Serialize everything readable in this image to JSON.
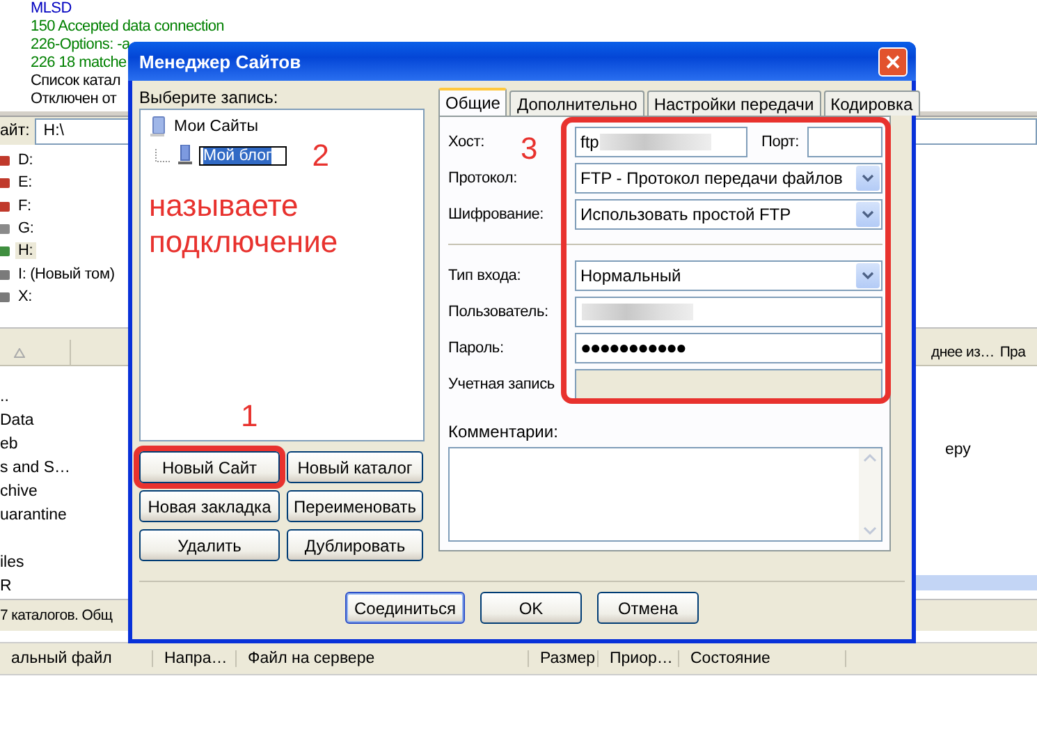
{
  "log": [
    {
      "text": "MLSD",
      "color": "#0000c0"
    },
    {
      "text": "150 Accepted data connection",
      "color": "#008000"
    },
    {
      "text": "226-Options: -a",
      "color": "#008000"
    },
    {
      "text": "226 18 matche",
      "color": "#008000"
    },
    {
      "text": "Список катал",
      "color": "#000000"
    },
    {
      "text": "Отключен от",
      "color": "#000000"
    }
  ],
  "local_path": {
    "label": "айт:",
    "value": "H:\\"
  },
  "drives": [
    {
      "label": "D:",
      "kind": "network",
      "selected": false
    },
    {
      "label": "E:",
      "kind": "network",
      "selected": false
    },
    {
      "label": "F:",
      "kind": "network",
      "selected": false
    },
    {
      "label": "G:",
      "kind": "cdrom",
      "selected": false
    },
    {
      "label": "H:",
      "kind": "usb",
      "selected": true
    },
    {
      "label": "I: (Новый том)",
      "kind": "disk",
      "selected": false
    },
    {
      "label": "X:",
      "kind": "disk",
      "selected": false
    }
  ],
  "local_files": [
    "..",
    "Data",
    "eb",
    "s and S…",
    "chive",
    "uarantine",
    "iles",
    "R"
  ],
  "local_status": "7 каталогов. Общ",
  "remote_columns": [
    "днее из…",
    "Пра"
  ],
  "remote_files": [
    "еру"
  ],
  "queue_columns": [
    "альный файл",
    "Напра…",
    "Файл на сервере",
    "Размер",
    "Приор…",
    "Состояние"
  ],
  "dialog": {
    "title": "Менеджер Сайтов",
    "select_label": "Выберите запись:",
    "tree": {
      "label": "Мои Сайты",
      "expanded": true,
      "children": [
        {
          "label": "Мой блог",
          "selected": true
        }
      ]
    },
    "tree_annotation_number": "2",
    "tree_annotation_note": "называете подключение",
    "buttons_annotation": "1",
    "site_buttons": [
      {
        "label": "Новый Сайт",
        "highlighted": true
      },
      {
        "label": "Новый каталог",
        "highlighted": false
      },
      {
        "label": "Новая закладка",
        "highlighted": false
      },
      {
        "label": "Переименовать",
        "highlighted": false
      },
      {
        "label": "Удалить",
        "highlighted": false
      },
      {
        "label": "Дублировать",
        "highlighted": false
      }
    ],
    "tabs": [
      {
        "label": "Общие",
        "selected": true
      },
      {
        "label": "Дополнительно",
        "selected": false
      },
      {
        "label": "Настройки передачи",
        "selected": false
      },
      {
        "label": "Кодировка",
        "selected": false
      }
    ],
    "form_annotation": "3",
    "form_highlighted": true,
    "host": {
      "label": "Хост:",
      "value": "ftp",
      "redacted": true
    },
    "port": {
      "label": "Порт:"
    },
    "protocol": {
      "label": "Протокол:",
      "value": "FTP - Протокол передачи файлов"
    },
    "encryption": {
      "label": "Шифрование:",
      "value": "Использовать простой FTP"
    },
    "logon_type": {
      "label": "Тип входа:",
      "value": "Нормальный"
    },
    "user": {
      "label": "Пользователь:",
      "redacted": true
    },
    "password": {
      "label": "Пароль:",
      "value": "●●●●●●●●●●●"
    },
    "account": {
      "label": "Учетная запись",
      "disabled": true
    },
    "comments": {
      "label": "Комментарии:"
    },
    "footer_buttons": [
      {
        "label": "Соединиться",
        "default": true
      },
      {
        "label": "OK",
        "default": false
      },
      {
        "label": "Отмена",
        "default": false
      }
    ]
  }
}
